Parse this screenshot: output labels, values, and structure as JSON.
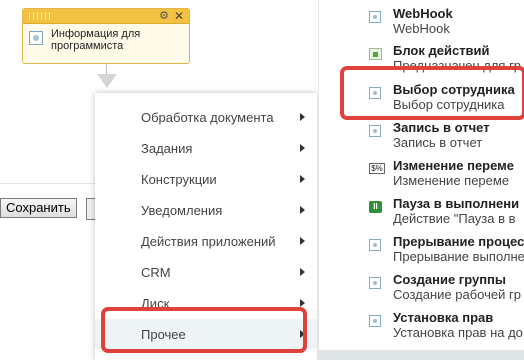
{
  "card": {
    "title": "Информация для программиста",
    "gear": "⚙",
    "close": "✕"
  },
  "buttons": {
    "save": "Сохранить"
  },
  "menu": {
    "items": [
      {
        "label": "Обработка документа"
      },
      {
        "label": "Задания"
      },
      {
        "label": "Конструкции"
      },
      {
        "label": "Уведомления"
      },
      {
        "label": "Действия приложений"
      },
      {
        "label": "CRM"
      },
      {
        "label": "Диск"
      },
      {
        "label": "Прочее"
      }
    ]
  },
  "panel": {
    "items": [
      {
        "title": "WebHook",
        "subtitle": "WebHook"
      },
      {
        "title": "Блок действий",
        "subtitle": "Предназначен для гр"
      },
      {
        "title": "Выбор сотрудника",
        "subtitle": "Выбор сотрудника"
      },
      {
        "title": "Запись в отчет",
        "subtitle": "Запись в отчет"
      },
      {
        "title": "Изменение переме",
        "subtitle": "Изменение переме",
        "icon_text": "$%"
      },
      {
        "title": "Пауза в выполнени",
        "subtitle": "Действие \"Пауза в в",
        "icon_text": "II"
      },
      {
        "title": "Прерывание процес",
        "subtitle": "Прерывание выполне"
      },
      {
        "title": "Создание группы",
        "subtitle": "Создание рабочей гр"
      },
      {
        "title": "Установка прав",
        "subtitle": "Установка прав на до"
      }
    ]
  },
  "colors": {
    "highlight_box": "#e0423b",
    "card_header": "#f4c242"
  }
}
